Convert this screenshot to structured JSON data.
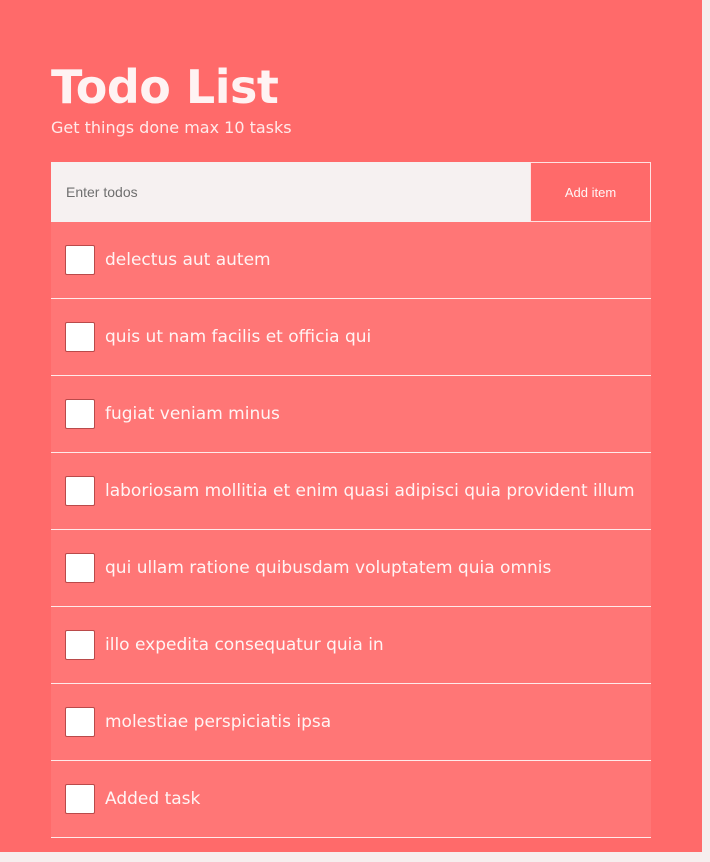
{
  "header": {
    "title": "Todo List",
    "subtitle": "Get things done max 10 tasks"
  },
  "form": {
    "input_placeholder": "Enter todos",
    "input_value": "",
    "add_label": "Add item"
  },
  "todos": [
    {
      "label": "delectus aut autem",
      "checked": false
    },
    {
      "label": "quis ut nam facilis et officia qui",
      "checked": false
    },
    {
      "label": "fugiat veniam minus",
      "checked": false
    },
    {
      "label": "laboriosam mollitia et enim quasi adipisci quia provident illum",
      "checked": false
    },
    {
      "label": "qui ullam ratione quibusdam voluptatem quia omnis",
      "checked": false
    },
    {
      "label": "illo expedita consequatur quia in",
      "checked": false
    },
    {
      "label": "molestiae perspiciatis ipsa",
      "checked": false
    },
    {
      "label": "Added task",
      "checked": false
    }
  ],
  "colors": {
    "background": "#ff6a6a",
    "item": "#ff7676",
    "input": "#f6f1f1"
  }
}
